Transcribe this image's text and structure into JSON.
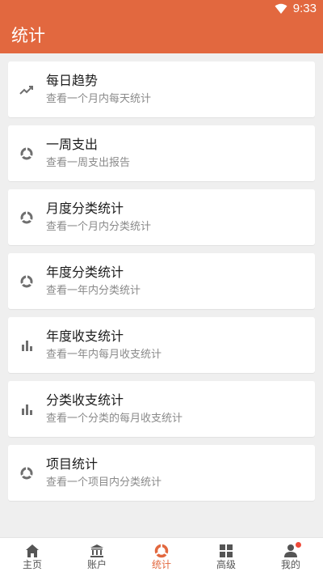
{
  "status_bar": {
    "time": "9:33"
  },
  "app_bar": {
    "title": "统计"
  },
  "items": [
    {
      "title": "每日趋势",
      "subtitle": "查看一个月内每天统计",
      "icon": "trending-up-icon"
    },
    {
      "title": "一周支出",
      "subtitle": "查看一周支出报告",
      "icon": "pie-chart-icon"
    },
    {
      "title": "月度分类统计",
      "subtitle": "查看一个月内分类统计",
      "icon": "pie-chart-icon"
    },
    {
      "title": "年度分类统计",
      "subtitle": "查看一年内分类统计",
      "icon": "pie-chart-icon"
    },
    {
      "title": "年度收支统计",
      "subtitle": "查看一年内每月收支统计",
      "icon": "bar-chart-icon"
    },
    {
      "title": "分类收支统计",
      "subtitle": "查看一个分类的每月收支统计",
      "icon": "bar-chart-icon"
    },
    {
      "title": "项目统计",
      "subtitle": "查看一个项目内分类统计",
      "icon": "pie-chart-icon"
    }
  ],
  "bottom_nav": [
    {
      "label": "主页",
      "icon": "home-icon",
      "active": false
    },
    {
      "label": "账户",
      "icon": "bank-icon",
      "active": false
    },
    {
      "label": "统计",
      "icon": "pie-chart-icon",
      "active": true
    },
    {
      "label": "高级",
      "icon": "grid-icon",
      "active": false
    },
    {
      "label": "我的",
      "icon": "person-icon",
      "active": false,
      "badge": true
    }
  ],
  "colors": {
    "primary": "#e2683f",
    "background": "#efefef",
    "icon_gray": "#6f6f6f",
    "badge": "#f04a3a"
  }
}
